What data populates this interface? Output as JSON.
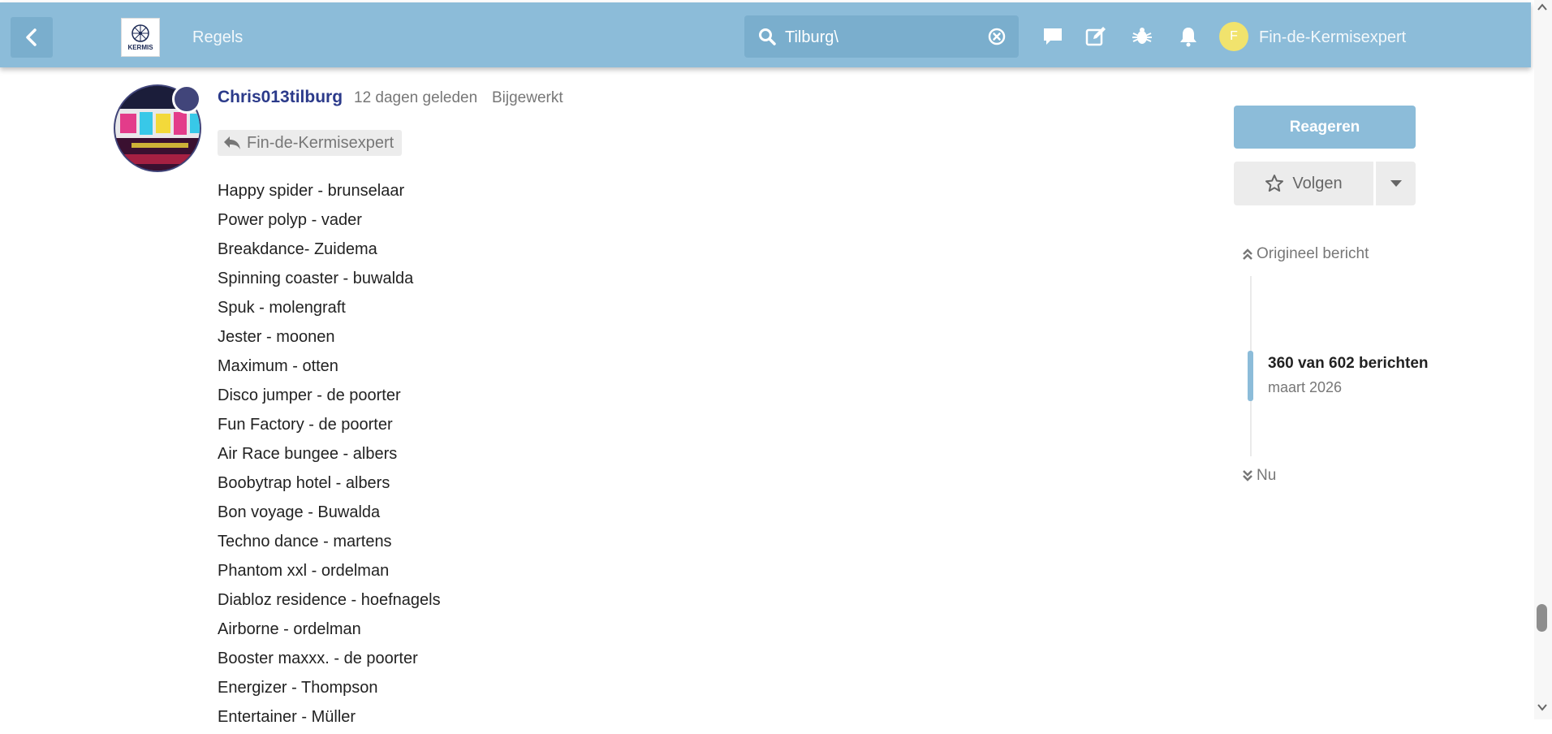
{
  "header": {
    "back_label": "‹",
    "logo_text": "KERMIS",
    "nav_link": "Regels",
    "search": {
      "value": "Tilburg\\",
      "placeholder": ""
    },
    "avatar_letter": "F",
    "username": "Fin-de-Kermisexpert",
    "colors": {
      "bar": "#8cbcd9",
      "search_bg": "#7aaecd",
      "avatar": "#f1e36d"
    }
  },
  "post": {
    "author": "Chris013tilburg",
    "time": "12 dagen geleden",
    "edited": "Bijgewerkt",
    "reply_to": "Fin-de-Kermisexpert",
    "lines": [
      "Happy spider - brunselaar",
      "Power polyp - vader",
      "Breakdance- Zuidema",
      "Spinning coaster - buwalda",
      "Spuk - molengraft",
      "Jester - moonen",
      "Maximum - otten",
      "Disco jumper - de poorter",
      "Fun Factory - de poorter",
      "Air Race bungee - albers",
      "Boobytrap hotel - albers",
      "Bon voyage - Buwalda",
      "Techno dance - martens",
      "Phantom xxl - ordelman",
      "Diabloz residence - hoefnagels",
      "Airborne - ordelman",
      "Booster maxxx. - de poorter",
      "Energizer - Thompson",
      "Entertainer - Müller"
    ]
  },
  "sidebar": {
    "reply_button": "Reageren",
    "follow_button": "Volgen",
    "original_post": "Origineel bericht",
    "position": "360 van 602 berichten",
    "date": "maart 2026",
    "now": "Nu"
  }
}
